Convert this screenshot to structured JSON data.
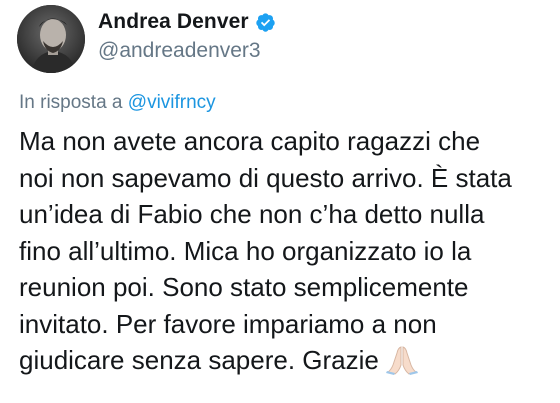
{
  "user": {
    "display_name": "Andrea Denver",
    "handle": "@andreadenver3",
    "verified": true,
    "verified_color": "#1da1f2"
  },
  "reply": {
    "prefix": "In risposta a",
    "handle": "@vivifrncy"
  },
  "tweet": {
    "lines": [
      "Ma non avete ancora capito ragazzi che",
      "noi non sapevamo di questo arrivo. È stata",
      "un’idea di Fabio che non c’ha detto nulla",
      "fino all’ultimo. Mica ho organizzato io la",
      "reunion poi. Sono stato semplicemente",
      "invitato. Per favore impariamo a non",
      "giudicare senza sapere. Grazie"
    ],
    "emoji": "folded-hands-emoji"
  },
  "colors": {
    "text": "#14171a",
    "secondary": "#657786",
    "link": "#1b95e0"
  }
}
